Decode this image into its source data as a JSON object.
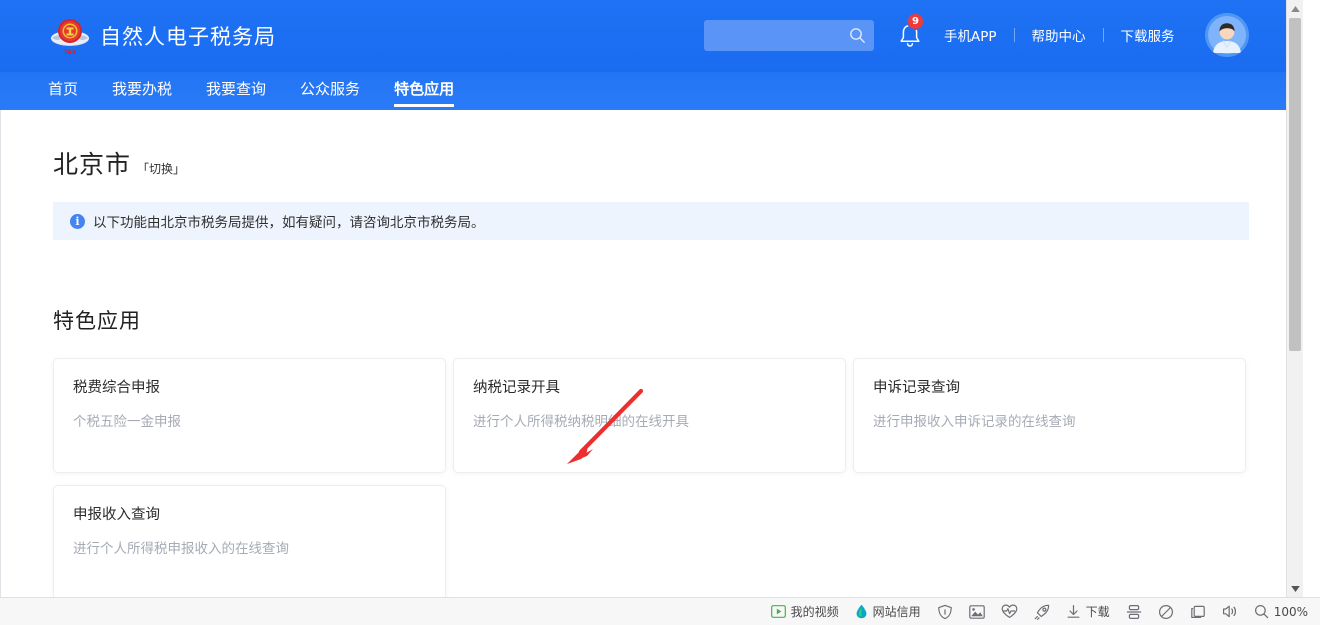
{
  "header": {
    "brand_title": "自然人电子税务局",
    "logo_icon": "tax-bureau-emblem-icon",
    "search": {
      "value": "",
      "placeholder": "",
      "icon": "search-icon"
    },
    "notification": {
      "icon": "bell-icon",
      "badge_count": "9"
    },
    "links": [
      {
        "label": "手机APP"
      },
      {
        "label": "帮助中心"
      },
      {
        "label": "下载服务"
      }
    ],
    "avatar_icon": "user-avatar-icon",
    "colors": {
      "header_blue": "#1b6ef3",
      "nav_blue": "#2477f5",
      "search_field": "#5b94f7",
      "badge_red": "#f03a3a"
    }
  },
  "nav": {
    "items": [
      {
        "label": "首页",
        "active": false
      },
      {
        "label": "我要办税",
        "active": false
      },
      {
        "label": "我要查询",
        "active": false
      },
      {
        "label": "公众服务",
        "active": false
      },
      {
        "label": "特色应用",
        "active": true
      }
    ]
  },
  "main": {
    "city": {
      "name": "北京市",
      "switch_label": "「切换」"
    },
    "notice": {
      "icon": "info-icon",
      "text": "以下功能由北京市税务局提供，如有疑问，请咨询北京市税务局。",
      "bg_color": "#eef4fe"
    },
    "section_title": "特色应用",
    "cards": [
      {
        "title": "税费综合申报",
        "desc": "个税五险一金申报"
      },
      {
        "title": "纳税记录开具",
        "desc": "进行个人所得税纳税明细的在线开具"
      },
      {
        "title": "申诉记录查询",
        "desc": "进行申报收入申诉记录的在线查询"
      },
      {
        "title": "申报收入查询",
        "desc": "进行个人所得税申报收入的在线查询"
      }
    ],
    "annotation": {
      "type": "red-arrow",
      "color": "#ee2e2e",
      "points_to": "纳税记录开具"
    }
  },
  "scrollbar": {
    "up_icon": "caret-up-icon",
    "down_icon": "caret-down-icon",
    "thumb_position": "top"
  },
  "statusbar": {
    "items": [
      {
        "icon": "my-video-icon",
        "label": "我的视频"
      },
      {
        "icon": "site-credit-droplet-icon",
        "label": "网站信用"
      },
      {
        "icon": "shield-icon",
        "label": ""
      },
      {
        "icon": "image-icon",
        "label": ""
      },
      {
        "icon": "heartbeat-icon",
        "label": ""
      },
      {
        "icon": "rocket-icon",
        "label": ""
      },
      {
        "icon": "download-icon",
        "label": "下载"
      },
      {
        "icon": "split-screen-icon",
        "label": ""
      },
      {
        "icon": "adblock-icon",
        "label": ""
      },
      {
        "icon": "sidebar-panel-icon",
        "label": ""
      },
      {
        "icon": "volume-icon",
        "label": ""
      },
      {
        "icon": "zoom-icon",
        "label": "100%"
      }
    ]
  }
}
